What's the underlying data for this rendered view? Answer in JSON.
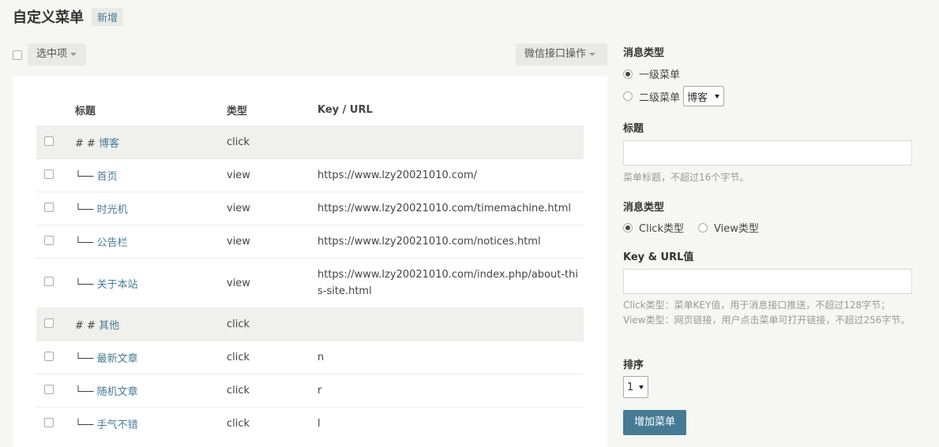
{
  "header": {
    "title": "自定义菜单",
    "add_label": "新增"
  },
  "toolbar": {
    "selected_label": "选中项",
    "wechat_label": "微信接口操作"
  },
  "table": {
    "columns": {
      "title": "标题",
      "type": "类型",
      "key": "Key / URL"
    },
    "rows": [
      {
        "group": true,
        "prefix": "# # ",
        "title": "博客",
        "type": "click",
        "key": ""
      },
      {
        "group": false,
        "prefix": "└── ",
        "title": "首页",
        "type": "view",
        "key": "https://www.lzy20021010.com/"
      },
      {
        "group": false,
        "prefix": "└── ",
        "title": "时光机",
        "type": "view",
        "key": "https://www.lzy20021010.com/timemachine.html"
      },
      {
        "group": false,
        "prefix": "└── ",
        "title": "公告栏",
        "type": "view",
        "key": "https://www.lzy20021010.com/notices.html"
      },
      {
        "group": false,
        "prefix": "└── ",
        "title": "关于本站",
        "type": "view",
        "key": "https://www.lzy20021010.com/index.php/about-this-site.html"
      },
      {
        "group": true,
        "prefix": "# # ",
        "title": "其他",
        "type": "click",
        "key": ""
      },
      {
        "group": false,
        "prefix": "└── ",
        "title": "最新文章",
        "type": "click",
        "key": "n"
      },
      {
        "group": false,
        "prefix": "└── ",
        "title": "随机文章",
        "type": "click",
        "key": "r"
      },
      {
        "group": false,
        "prefix": "└── ",
        "title": "手气不错",
        "type": "click",
        "key": "l"
      }
    ]
  },
  "form": {
    "level_label": "消息类型",
    "level_one": "一级菜单",
    "level_two": "二级菜单",
    "parent_value": "博客",
    "title_label": "标题",
    "title_value": "",
    "title_hint": "菜单标题，不超过16个字节。",
    "type_label": "消息类型",
    "type_click": "Click类型",
    "type_view": "View类型",
    "key_label": "Key & URL值",
    "key_value": "",
    "key_hint_1": "Click类型：菜单KEY值，用于消息接口推送，不超过128字节；",
    "key_hint_2": "View类型：网页链接，用户点击菜单可打开链接，不超过256字节。",
    "sort_label": "排序",
    "sort_value": "1",
    "submit_label": "增加菜单"
  },
  "colors": {
    "accent": "#467b96",
    "group_row": "#f0f0ec",
    "page_bg": "#f6f6f3"
  }
}
